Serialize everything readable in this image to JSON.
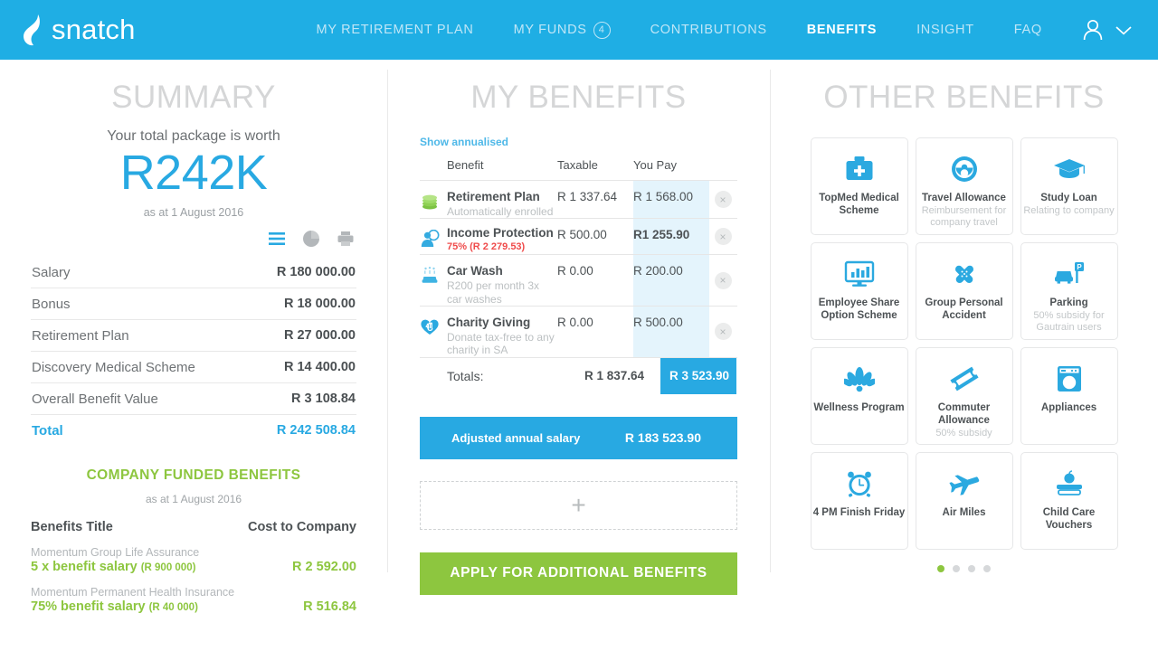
{
  "header": {
    "brand": "snatch",
    "brand_icon": "snatch-leaf-logo",
    "nav": [
      {
        "label": "MY RETIREMENT PLAN",
        "badge": null,
        "active": false
      },
      {
        "label": "MY FUNDS",
        "badge": "4",
        "active": false
      },
      {
        "label": "CONTRIBUTIONS",
        "badge": null,
        "active": false
      },
      {
        "label": "BENEFITS",
        "badge": null,
        "active": true
      },
      {
        "label": "INSIGHT",
        "badge": null,
        "active": false
      },
      {
        "label": "FAQ",
        "badge": null,
        "active": false
      }
    ],
    "account_icon": "user-avatar-icon",
    "account_chevron": "chevron-down-icon",
    "background_color": "#1faee4"
  },
  "summary": {
    "title": "SUMMARY",
    "subtitle": "Your total package is worth",
    "total_value": "R242K",
    "as_at": "as at 1 August 2016",
    "view_icons": [
      "list-view-icon",
      "pie-chart-icon",
      "print-icon"
    ],
    "rows": [
      {
        "label": "Salary",
        "value": "R 180 000.00"
      },
      {
        "label": "Bonus",
        "value": "R 18 000.00"
      },
      {
        "label": "Retirement Plan",
        "value": "R 27 000.00"
      },
      {
        "label": "Discovery Medical Scheme",
        "value": "R 14 400.00"
      },
      {
        "label": "Overall Benefit Value",
        "value": "R 3 108.84"
      }
    ],
    "total_row": {
      "label": "Total",
      "value": "R 242 508.84"
    },
    "company_funded": {
      "title": "COMPANY FUNDED BENEFITS",
      "as_at": "as at 1 August 2016",
      "col_title": "Benefits Title",
      "col_cost": "Cost to Company",
      "items": [
        {
          "provider": "Momentum Group Life Assurance",
          "desc": "5 x benefit salary ",
          "paren": "(R 900 000)",
          "amount": "R 2 592.00"
        },
        {
          "provider": "Momentum Permanent Health Insurance",
          "desc": "75% benefit salary ",
          "paren": "(R 40 000)",
          "amount": "R 516.84"
        }
      ]
    }
  },
  "my_benefits": {
    "title": "MY BENEFITS",
    "show_annualised": "Show annualised",
    "columns": {
      "benefit": "Benefit",
      "taxable": "Taxable",
      "you_pay": "You Pay"
    },
    "rows": [
      {
        "icon": "coins-stack-icon",
        "name": "Retirement Plan",
        "desc": "Automatically enrolled",
        "desc_red": "",
        "taxable": "R 1 337.64",
        "you_pay": "R 1 568.00",
        "remove": "×"
      },
      {
        "icon": "income-protection-person-icon",
        "name": "Income Protection",
        "desc": "",
        "desc_red": "75% (R 2 279.53)",
        "taxable": "R 500.00",
        "you_pay": "R1 255.90",
        "remove": "×"
      },
      {
        "icon": "car-wash-icon",
        "name": "Car Wash",
        "desc": "R200 per month 3x car washes",
        "desc_red": "",
        "taxable": "R 0.00",
        "you_pay": "R 200.00",
        "remove": "×"
      },
      {
        "icon": "charity-heart-hand-icon",
        "name": "Charity Giving",
        "desc": "Donate tax-free to any charity in SA",
        "desc_red": "",
        "taxable": "R 0.00",
        "you_pay": "R 500.00",
        "remove": "×"
      }
    ],
    "totals": {
      "label": "Totals:",
      "taxable": "R 1 837.64",
      "you_pay": "R 3 523.90"
    },
    "adjusted": {
      "label": "Adjusted annual salary",
      "value": "R 183 523.90"
    },
    "add_button": "+",
    "apply_button": "APPLY FOR ADDITIONAL BENEFITS"
  },
  "other_benefits": {
    "title": "OTHER BENEFITS",
    "cards": [
      {
        "icon": "medical-kit-icon",
        "label": "TopMed Medical Scheme",
        "sub": ""
      },
      {
        "icon": "steering-wheel-icon",
        "label": "Travel Allowance",
        "sub": "Reimbursement for company travel"
      },
      {
        "icon": "graduation-cap-icon",
        "label": "Study Loan",
        "sub": "Relating to company"
      },
      {
        "icon": "monitor-chart-icon",
        "label": "Employee Share Option Scheme",
        "sub": ""
      },
      {
        "icon": "plasters-cross-icon",
        "label": "Group Personal Accident",
        "sub": ""
      },
      {
        "icon": "car-parking-icon",
        "label": "Parking",
        "sub": "50% subsidy for Gautrain users"
      },
      {
        "icon": "lotus-flower-icon",
        "label": "Wellness Program",
        "sub": ""
      },
      {
        "icon": "ticket-icon",
        "label": "Commuter Allowance",
        "sub": "50% subsidy"
      },
      {
        "icon": "washing-machine-icon",
        "label": "Appliances",
        "sub": ""
      },
      {
        "icon": "alarm-clock-icon",
        "label": "4 PM Finish Friday",
        "sub": ""
      },
      {
        "icon": "airplane-icon",
        "label": "Air Miles",
        "sub": ""
      },
      {
        "icon": "apple-books-icon",
        "label": "Child Care Vouchers",
        "sub": ""
      }
    ],
    "pagination": {
      "count": 4,
      "active_index": 0
    }
  },
  "colors": {
    "brand_blue": "#1faee4",
    "accent_blue": "#28a9e2",
    "accent_green": "#8dc63f",
    "alert_red": "#ef4b4b",
    "pay_highlight": "#e4f4fc"
  }
}
